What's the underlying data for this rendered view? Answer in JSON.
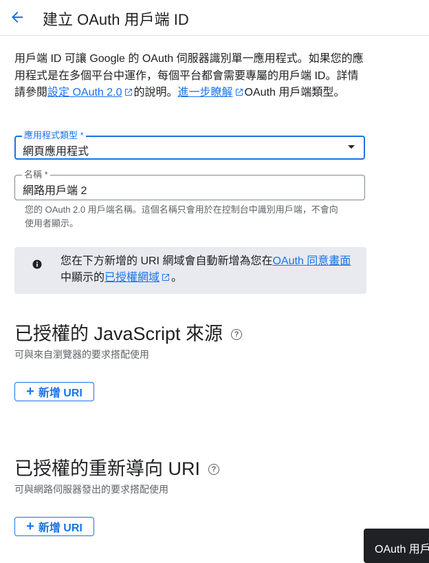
{
  "header": {
    "title": "建立 OAuth 用戶端 ID",
    "back_icon": "arrow-back-icon"
  },
  "intro": {
    "text_1": "用戶端 ID 可讓 Google 的 OAuth 伺服器識別單一應用程式。如果您的應用程式是在多個平台中運作，每個平台都會需要專屬的用戶端 ID。詳情請參閱",
    "link_1": "設定 OAuth 2.0",
    "text_2": "的說明。",
    "link_2": "進一步瞭解",
    "text_3": "OAuth 用戶端類型。"
  },
  "form": {
    "app_type": {
      "label": "應用程式類型 *",
      "value": "網頁應用程式"
    },
    "name": {
      "label": "名稱 *",
      "value": "網路用戶端 2",
      "hint": "您的 OAuth 2.0 用戶端名稱。這個名稱只會用於在控制台中識別用戶端，不會向使用者顯示。"
    }
  },
  "info": {
    "text_1": "您在下方新增的 URI 網域會自動新增為您在",
    "link_1": "OAuth 同意畫面",
    "text_2": "中顯示的",
    "link_2": "已授權網域",
    "text_3": "。"
  },
  "js_origins": {
    "title": "已授權的 JavaScript 來源",
    "description": "可與來自瀏覽器的要求搭配使用",
    "add_button": "新增 URI"
  },
  "redirect_uris": {
    "title": "已授權的重新導向 URI",
    "description": "可與網路伺服器發出的要求搭配使用",
    "add_button": "新增 URI"
  },
  "toast": {
    "text": "OAuth 用戶"
  },
  "colors": {
    "accent": "#1a73e8",
    "info_bg": "#e8eaf0",
    "text": "#202124",
    "muted": "#5f6368"
  }
}
